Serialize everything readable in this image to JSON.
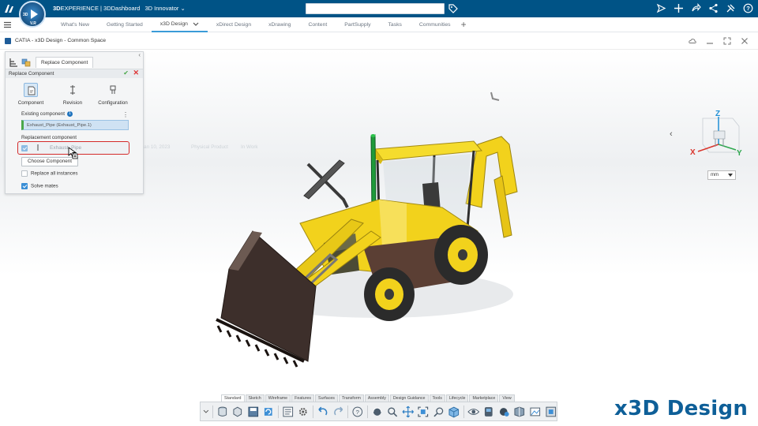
{
  "topbar": {
    "brand_prefix": "3D",
    "brand_rest": "EXPERIENCE | 3DDashboard",
    "app_switch_label": "3D Innovator",
    "compass_labels": [
      "3D",
      "V.R"
    ],
    "search_value": "",
    "icons": [
      "share-icon",
      "add-icon",
      "forward-icon",
      "network-icon",
      "tools-icon",
      "help-icon"
    ]
  },
  "tabs": {
    "items": [
      {
        "label": "What's New",
        "active": false
      },
      {
        "label": "Getting Started",
        "active": false
      },
      {
        "label": "x3D Design",
        "active": true
      },
      {
        "label": "xDirect Design",
        "active": false
      },
      {
        "label": "xDrawing",
        "active": false
      },
      {
        "label": "Content",
        "active": false
      },
      {
        "label": "PartSupply",
        "active": false
      },
      {
        "label": "Tasks",
        "active": false
      },
      {
        "label": "Communities",
        "active": false
      }
    ]
  },
  "document": {
    "title": "CATIA - x3D Design - Common Space"
  },
  "panel": {
    "tab_label": "Replace Component",
    "header": "Replace Component",
    "modes": [
      {
        "label": "Component",
        "selected": true
      },
      {
        "label": "Revision",
        "selected": false
      },
      {
        "label": "Configuration",
        "selected": false
      }
    ],
    "existing_label": "Existing component",
    "existing_count": "1",
    "existing_value": "Exhaust_Pipe (Exhaust_Pipe.1)",
    "replacement_label": "Replacement component",
    "replacement_value": "Exhaust_Pipe",
    "drag_ghost": {
      "date": "Jan 10, 2023",
      "type": "Physical Product",
      "state": "In Work"
    },
    "choose_label": "Choose Component",
    "replace_all_label": "Replace all instances",
    "replace_all_checked": false,
    "solve_mates_label": "Solve mates",
    "solve_mates_checked": true
  },
  "viewport": {
    "units": "mm",
    "axes": [
      "Z",
      "X",
      "Y"
    ],
    "colors": {
      "z": "#1e8fd6",
      "x": "#d9342b",
      "y": "#2fa84f",
      "body": "#f2d21c",
      "bucket": "#3d2f2b"
    }
  },
  "action_bar": {
    "tabs": [
      "Standard",
      "Sketch",
      "Wireframe",
      "Features",
      "Surfaces",
      "Transform",
      "Assembly",
      "Design Guidance",
      "Tools",
      "Lifecycle",
      "Marketplace",
      "View"
    ],
    "active_tab": "Standard"
  },
  "watermark": "x3D Design"
}
